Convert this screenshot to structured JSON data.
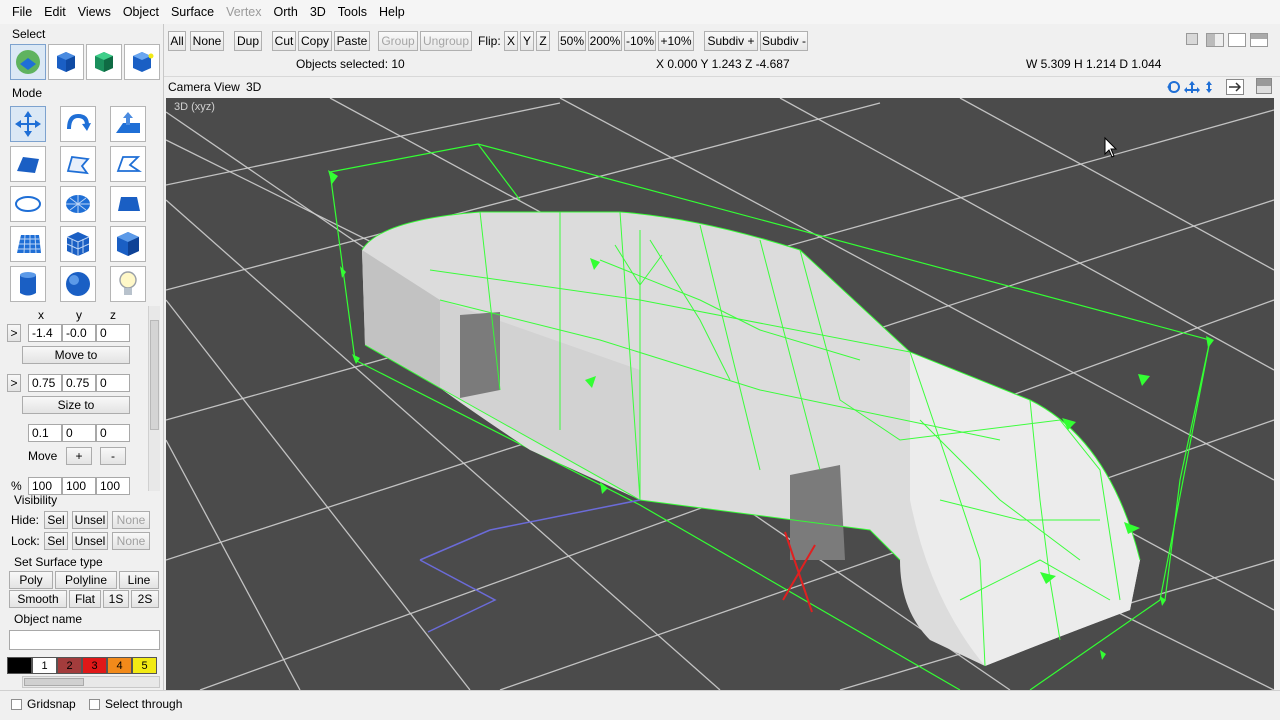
{
  "menu": [
    "File",
    "Edit",
    "Views",
    "Object",
    "Surface",
    "Vertex",
    "Orth",
    "3D",
    "Tools",
    "Help"
  ],
  "left": {
    "select_title": "Select",
    "mode_title": "Mode",
    "axis_labels": [
      "x",
      "y",
      "z"
    ],
    "arrow": ">",
    "pos": [
      "-1.4",
      "-0.0",
      "0"
    ],
    "move_to": "Move to",
    "size": [
      "0.75",
      "0.75",
      "0"
    ],
    "size_to": "Size to",
    "move_vals": [
      "0.1",
      "0",
      "0"
    ],
    "move_label": "Move",
    "plus": "+",
    "minus": "-",
    "pct_label": "%",
    "pct": [
      "100",
      "100",
      "100"
    ],
    "visibility_title": "Visibility",
    "hide_label": "Hide:",
    "lock_label": "Lock:",
    "sel": "Sel",
    "unsel": "Unsel",
    "none": "None",
    "surface_title": "Set Surface type",
    "surface_types": [
      "Poly",
      "Polyline",
      "Line",
      "Smooth",
      "Flat",
      "1S",
      "2S"
    ],
    "object_name_title": "Object name",
    "object_name_value": "",
    "palette": [
      {
        "label": "",
        "color": "#000000"
      },
      {
        "label": "1",
        "color": "#ffffff"
      },
      {
        "label": "2",
        "color": "#a33c3c"
      },
      {
        "label": "3",
        "color": "#e01818"
      },
      {
        "label": "4",
        "color": "#f28a1a"
      },
      {
        "label": "5",
        "color": "#f2ea14"
      }
    ]
  },
  "toolbar": {
    "buttons": [
      "All",
      "None",
      "Dup",
      "Cut",
      "Copy",
      "Paste",
      "Group",
      "Ungroup"
    ],
    "flip_label": "Flip:",
    "flip": [
      "X",
      "Y",
      "Z"
    ],
    "zoom": [
      "50%",
      "200%",
      "-10%",
      "+10%"
    ],
    "subdiv": [
      "Subdiv +",
      "Subdiv -"
    ],
    "objects_selected": "Objects selected: 10",
    "coords": "X 0.000 Y 1.243 Z -4.687",
    "dims": "W 5.309 H 1.214 D 1.044"
  },
  "view": {
    "camera": "Camera",
    "view": "View",
    "threed": "3D",
    "viewport_label": "3D (xyz)"
  },
  "status": {
    "gridsnap": "Gridsnap",
    "select_through": "Select through"
  },
  "colors": {
    "viewport_bg": "#4b4b4b",
    "wire": "#33ff33",
    "accent_blue": "#1f6fd6"
  }
}
